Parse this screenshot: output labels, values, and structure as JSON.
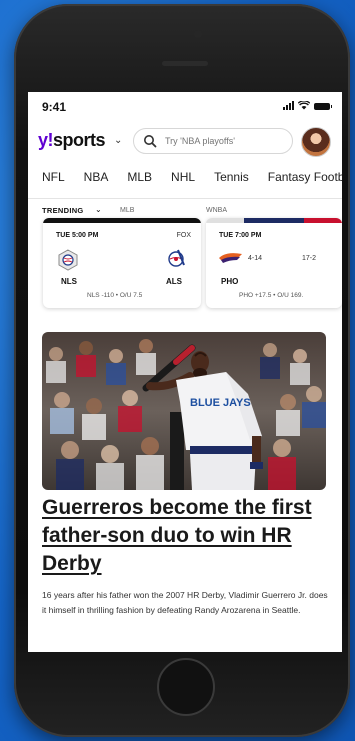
{
  "status": {
    "time": "9:41"
  },
  "header": {
    "logo_y": "y!",
    "logo_sports": "sports",
    "search_placeholder": "Try 'NBA playoffs'"
  },
  "nav": {
    "tabs": [
      "NFL",
      "NBA",
      "MLB",
      "NHL",
      "Tennis",
      "Fantasy Footb"
    ]
  },
  "trending": {
    "label": "TRENDING",
    "leagues": [
      "MLB",
      "WNBA"
    ]
  },
  "games": [
    {
      "time": "TUE 5:00 PM",
      "network": "FOX",
      "away": {
        "abbr": "NLS"
      },
      "home": {
        "abbr": "ALS"
      },
      "odds": "NLS -110  •  O/U 7.5"
    },
    {
      "time": "TUE 7:00 PM",
      "away": {
        "abbr": "PHO",
        "record": "4-14"
      },
      "home": {
        "record": "17-2"
      },
      "odds": "PHO +17.5  •  O/U 169."
    }
  ],
  "article": {
    "headline": "Guerreros become the first father-son duo to win HR Derby",
    "summary": "16 years after his father won the 2007 HR Derby, Vladimir Guerrero Jr. does it himself in thrilling fashion by defeating Randy Arozarena in Seattle.",
    "jersey_text": "BLUE JAYS"
  },
  "colors": {
    "brand": "#6001d2",
    "background": "#1565c8"
  }
}
